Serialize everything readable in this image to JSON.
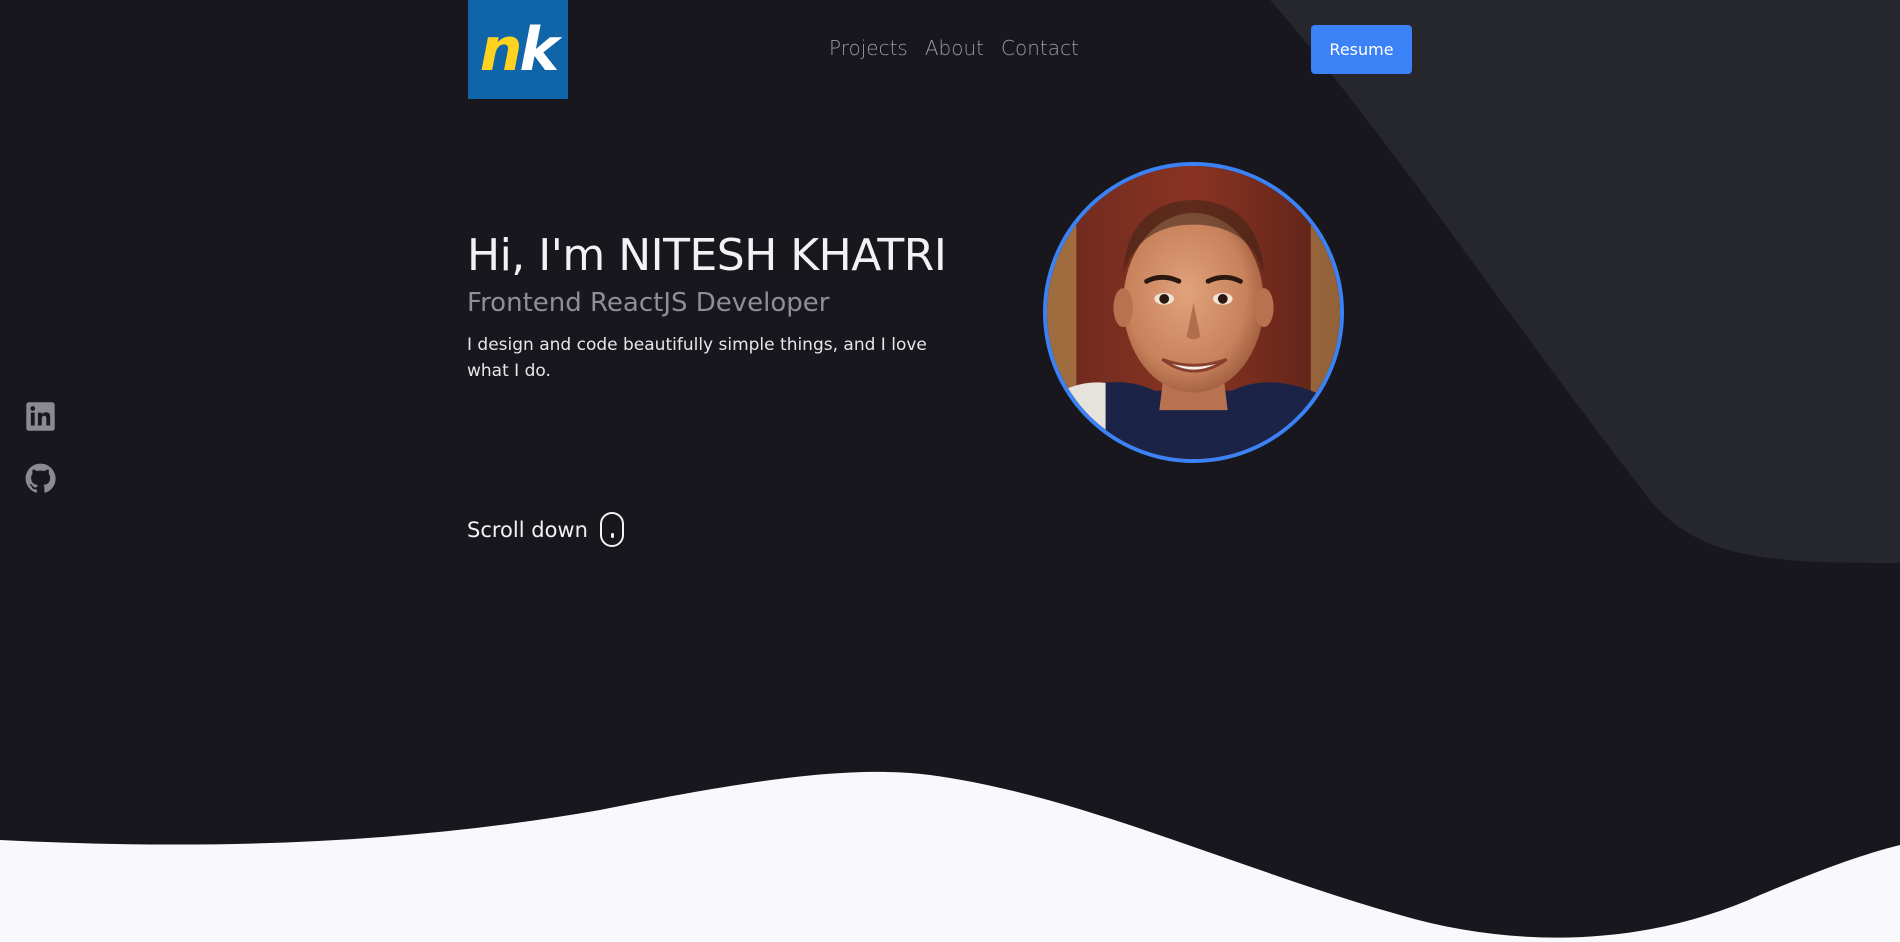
{
  "logo": {
    "first": "n",
    "second": "k"
  },
  "nav": {
    "items": [
      "Projects",
      "About",
      "Contact"
    ]
  },
  "resume": {
    "label": "Resume"
  },
  "social": {
    "items": [
      "linkedin-icon",
      "github-icon"
    ]
  },
  "hero": {
    "greeting": "Hi, I'm NITESH KHATRI",
    "role": "Frontend ReactJS Developer",
    "tagline": "I design and code beautifully simple things, and I love what I do."
  },
  "scroll": {
    "label": "Scroll down"
  },
  "colors": {
    "background": "#17171d",
    "accent": "#3b82f6",
    "logo_bg": "#0f65a8",
    "logo_yellow": "#ffd21f",
    "light_section": "#f8f8fd",
    "shape": "#26262d"
  }
}
